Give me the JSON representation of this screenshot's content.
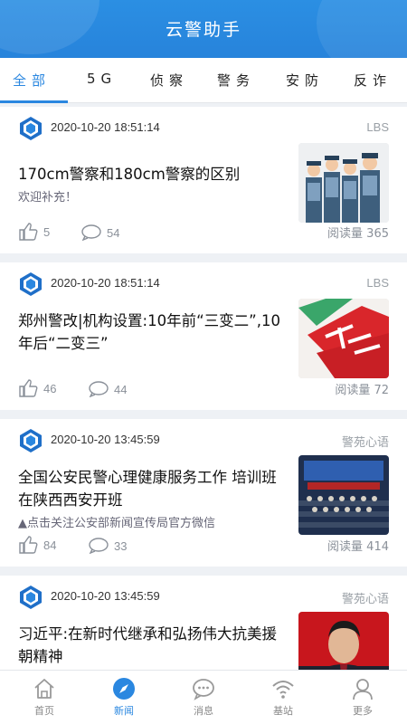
{
  "header": {
    "title": "云警助手"
  },
  "tabs": [
    {
      "label": "全部"
    },
    {
      "label": "5G"
    },
    {
      "label": "侦察"
    },
    {
      "label": "警务"
    },
    {
      "label": "安防"
    },
    {
      "label": "反诈"
    }
  ],
  "articles": [
    {
      "time": "2020-10-20 18:51:14",
      "source": "LBS",
      "title": "170cm警察和180cm警察的区别",
      "subtitle": "欢迎补充！",
      "likes": "5",
      "comments": "54",
      "reads": "阅读量 365",
      "thumb": "police-officers-cartoon"
    },
    {
      "time": "2020-10-20 18:51:14",
      "source": "LBS",
      "title": "郑州警改|机构设置:10年前“三变二”,10年后“二变三”",
      "subtitle": "",
      "likes": "46",
      "comments": "44",
      "reads": "阅读量 72",
      "thumb": "red-character-graphic"
    },
    {
      "time": "2020-10-20 13:45:59",
      "source": "警苑心语",
      "title": "全国公安民警心理健康服务工作 培训班在陕西西安开班",
      "subtitle": "▲点击关注公安部新闻宣传局官方微信",
      "likes": "84",
      "comments": "33",
      "reads": "阅读量 414",
      "thumb": "conference-hall-photo"
    },
    {
      "time": "2020-10-20 13:45:59",
      "source": "警苑心语",
      "title": "习近平:在新时代继承和弘扬伟大抗美援朝精神",
      "subtitle": "",
      "likes": "",
      "comments": "",
      "reads": "",
      "thumb": "portrait-photo"
    }
  ],
  "bottom_nav": [
    {
      "label": "首页",
      "icon": "home-icon"
    },
    {
      "label": "新闻",
      "icon": "compass-icon"
    },
    {
      "label": "消息",
      "icon": "message-icon"
    },
    {
      "label": "基站",
      "icon": "signal-icon"
    },
    {
      "label": "更多",
      "icon": "user-icon"
    }
  ],
  "colors": {
    "accent": "#2a87e0",
    "header": "#2b8fe3"
  }
}
